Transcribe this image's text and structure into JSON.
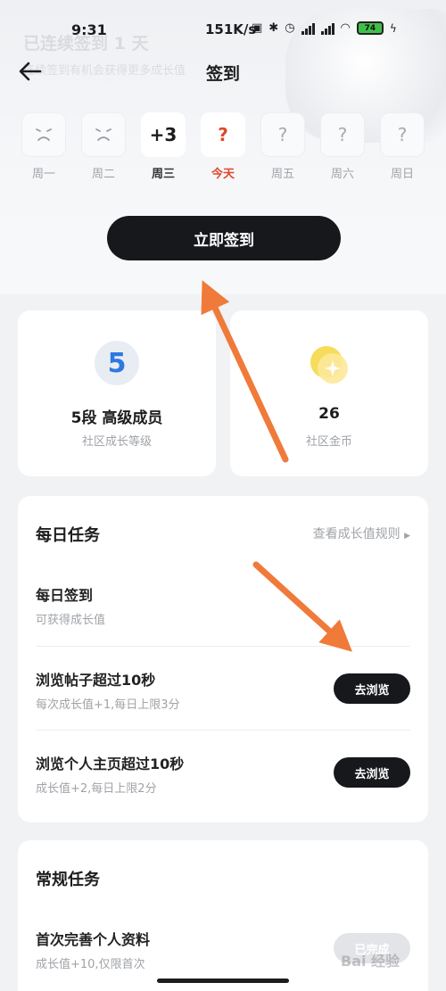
{
  "status_bar": {
    "time": "9:31",
    "net_speed": "151K/s",
    "battery": "74"
  },
  "background": {
    "title": "已连续签到 1 天",
    "subtitle": "连续签到有机会获得更多成长值"
  },
  "nav": {
    "title": "签到"
  },
  "week": [
    {
      "box": "",
      "label": "周一",
      "state": "done"
    },
    {
      "box": "",
      "label": "周二",
      "state": "done"
    },
    {
      "box": "+3",
      "label": "周三",
      "state": "plus"
    },
    {
      "box": "?",
      "label": "今天",
      "state": "today"
    },
    {
      "box": "?",
      "label": "周五",
      "state": "future"
    },
    {
      "box": "?",
      "label": "周六",
      "state": "future"
    },
    {
      "box": "?",
      "label": "周日",
      "state": "future"
    }
  ],
  "signin": {
    "label": "立即签到"
  },
  "stats": {
    "level": {
      "badge": "5",
      "value": "5段 高级成员",
      "label": "社区成长等级"
    },
    "coins": {
      "value": "26",
      "label": "社区金币"
    }
  },
  "daily": {
    "title": "每日任务",
    "link": "查看成长值规则",
    "tasks": [
      {
        "name": "每日签到",
        "desc": "可获得成长值",
        "button": ""
      },
      {
        "name": "浏览帖子超过10秒",
        "desc": "每次成长值+1,每日上限3分",
        "button": "去浏览"
      },
      {
        "name": "浏览个人主页超过10秒",
        "desc": "成长值+2,每日上限2分",
        "button": "去浏览"
      }
    ]
  },
  "regular": {
    "title": "常规任务",
    "tasks": [
      {
        "name": "首次完善个人资料",
        "desc": "成长值+10,仅限首次",
        "button": "已完成"
      }
    ]
  },
  "watermark": "Bai 经验",
  "colors": {
    "accent": "#e0482a",
    "button": "#17181c",
    "annotation_arrow": "#f07a3a"
  },
  "icons": {
    "back": "arrow-left-icon",
    "coin": "coin-icon",
    "link_arrow": "triangle-right-icon"
  }
}
